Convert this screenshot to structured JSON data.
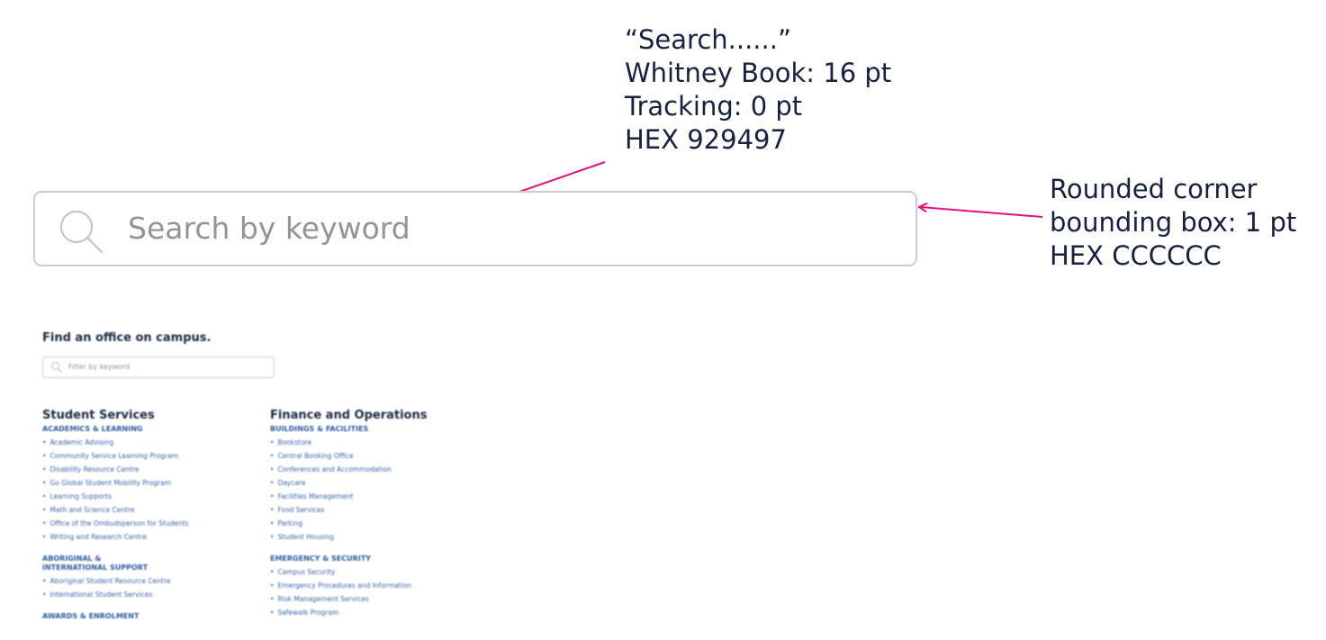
{
  "search": {
    "placeholder": "Search by  keyword",
    "icon": "search-icon",
    "border_color": "#CCCCCC",
    "placeholder_color": "#929497"
  },
  "annotations": {
    "placeholder_note": [
      "“Search......”",
      "Whitney Book: 16 pt",
      "Tracking: 0 pt",
      "HEX 929497"
    ],
    "box_note": [
      "Rounded corner",
      "bounding box: 1 pt",
      "HEX CCCCCC"
    ],
    "arrow_color": "#e0127e"
  },
  "preview": {
    "heading": "Find an office on campus.",
    "filter_placeholder": "Filter by keyword",
    "columns": [
      {
        "title": "Student Services",
        "groups": [
          {
            "title": "ACADEMICS & LEARNING",
            "items": [
              "Academic Advising",
              "Community Service Learning Program",
              "Disability Resource Centre",
              "Go Global Student Mobility Program",
              "Learning Supports",
              "Math and Science Centre",
              "Office of the Ombudsperson for Students",
              "Writing and Research Centre"
            ]
          },
          {
            "title": "ABORIGINAL & INTERNATIONAL SUPPORT",
            "items": [
              "Aboriginal Student Resource Centre",
              "International Student Services"
            ]
          },
          {
            "title": "AWARDS & ENROLMENT",
            "items": []
          }
        ]
      },
      {
        "title": "Finance and Operations",
        "groups": [
          {
            "title": "BUILDINGS & FACILITIES",
            "items": [
              "Bookstore",
              "Central Booking Office",
              "Conferences and Accommodation",
              "Daycare",
              "Facilities Management",
              "Food Services",
              "Parking",
              "Student Housing"
            ]
          },
          {
            "title": "EMERGENCY & SECURITY",
            "items": [
              "Campus Security",
              "Emergency Procedures and Information",
              "Risk Management Services",
              "Safewalk Program"
            ]
          }
        ]
      }
    ]
  }
}
